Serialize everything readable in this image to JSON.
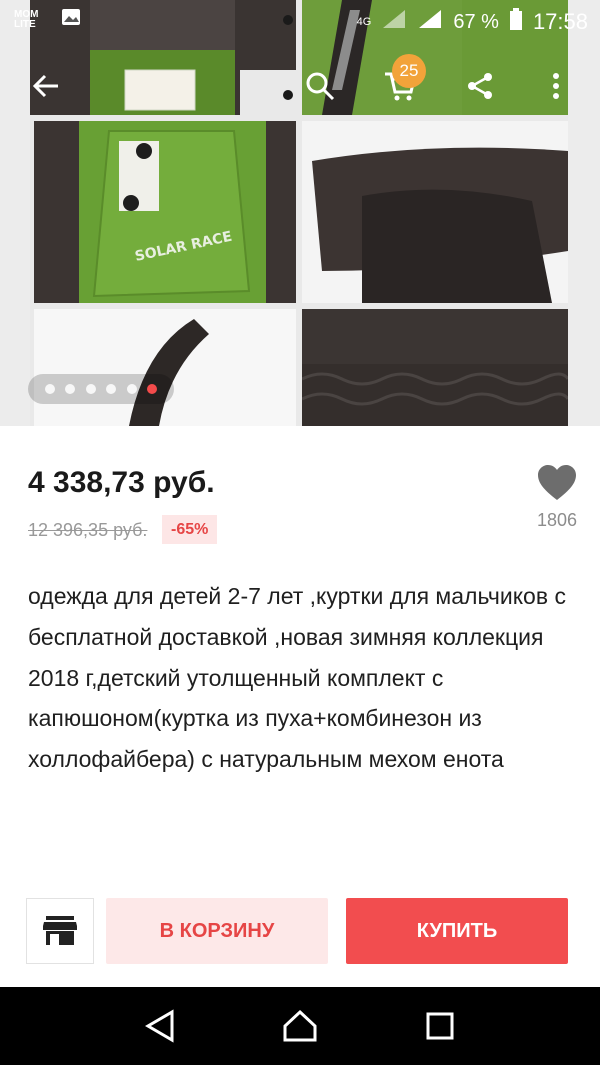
{
  "status_bar": {
    "app_badge": "MOM LITE",
    "network": "4G",
    "battery": "67 %",
    "time": "17:58"
  },
  "toolbar": {
    "back_icon": "arrow-left-icon",
    "search_icon": "search-icon",
    "cart_icon": "cart-icon",
    "cart_count": "25",
    "share_icon": "share-icon",
    "more_icon": "more-vertical-icon"
  },
  "gallery": {
    "total_images": 6,
    "active_index": 5,
    "accent": "#f44b4b"
  },
  "product": {
    "price": "4 338,73 руб.",
    "old_price": "12 396,35 руб.",
    "discount": "-65%",
    "likes": "1806",
    "title": "одежда для детей 2-7 лет ,куртки для мальчиков с бесплатной доставкой  ,новая зимняя  коллекция 2018 г,детский утолщенный комплект с капюшоном(куртка из пуха+комбинезон из холлофайбера) с натуральным мехом енота"
  },
  "actions": {
    "store_icon": "store-icon",
    "add_to_cart": "В КОРЗИНУ",
    "buy": "КУПИТЬ",
    "buy_color": "#f24d4f",
    "cart_color": "#fde8e8"
  },
  "nav": {
    "back": "back-triangle-icon",
    "home": "home-icon",
    "recents": "recents-square-icon"
  }
}
